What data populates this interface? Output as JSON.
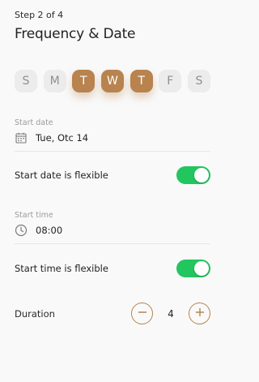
{
  "header": {
    "step": "Step 2 of 4",
    "title": "Frequency & Date"
  },
  "days": [
    {
      "label": "S",
      "active": false
    },
    {
      "label": "M",
      "active": false
    },
    {
      "label": "T",
      "active": true
    },
    {
      "label": "W",
      "active": true
    },
    {
      "label": "T",
      "active": true
    },
    {
      "label": "F",
      "active": false
    },
    {
      "label": "S",
      "active": false
    }
  ],
  "start_date": {
    "label": "Start date",
    "value": "Tue, Otc 14",
    "icon": "calendar-icon"
  },
  "start_date_flexible": {
    "label": "Start date is flexible",
    "on": true
  },
  "start_time": {
    "label": "Start time",
    "value": "08:00",
    "icon": "clock-icon"
  },
  "start_time_flexible": {
    "label": "Start time is flexible",
    "on": true
  },
  "duration": {
    "label": "Duration",
    "value": "4",
    "decrement_icon": "minus-icon",
    "increment_icon": "plus-icon"
  },
  "colors": {
    "accent": "#b8834f",
    "toggle_on": "#22c55e"
  }
}
